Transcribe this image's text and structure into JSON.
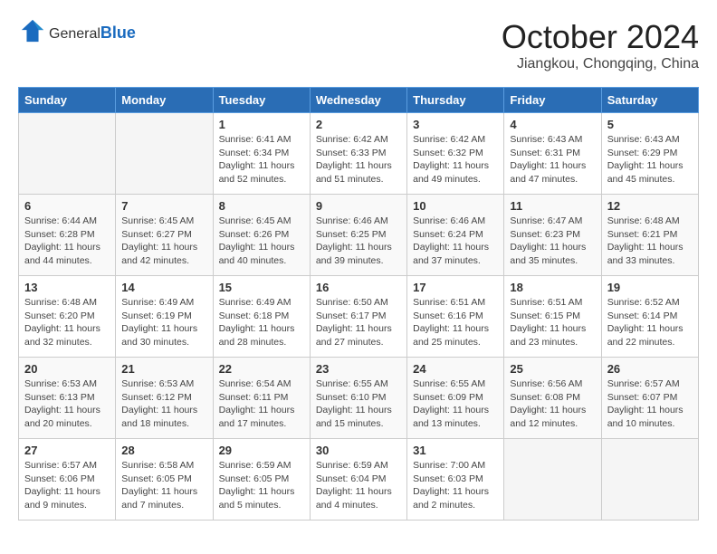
{
  "header": {
    "logo_general": "General",
    "logo_blue": "Blue",
    "month_title": "October 2024",
    "location": "Jiangkou, Chongqing, China"
  },
  "days_of_week": [
    "Sunday",
    "Monday",
    "Tuesday",
    "Wednesday",
    "Thursday",
    "Friday",
    "Saturday"
  ],
  "weeks": [
    [
      {
        "day": "",
        "info": "",
        "empty": true
      },
      {
        "day": "",
        "info": "",
        "empty": true
      },
      {
        "day": "1",
        "info": "Sunrise: 6:41 AM\nSunset: 6:34 PM\nDaylight: 11 hours and 52 minutes."
      },
      {
        "day": "2",
        "info": "Sunrise: 6:42 AM\nSunset: 6:33 PM\nDaylight: 11 hours and 51 minutes."
      },
      {
        "day": "3",
        "info": "Sunrise: 6:42 AM\nSunset: 6:32 PM\nDaylight: 11 hours and 49 minutes."
      },
      {
        "day": "4",
        "info": "Sunrise: 6:43 AM\nSunset: 6:31 PM\nDaylight: 11 hours and 47 minutes."
      },
      {
        "day": "5",
        "info": "Sunrise: 6:43 AM\nSunset: 6:29 PM\nDaylight: 11 hours and 45 minutes."
      }
    ],
    [
      {
        "day": "6",
        "info": "Sunrise: 6:44 AM\nSunset: 6:28 PM\nDaylight: 11 hours and 44 minutes."
      },
      {
        "day": "7",
        "info": "Sunrise: 6:45 AM\nSunset: 6:27 PM\nDaylight: 11 hours and 42 minutes."
      },
      {
        "day": "8",
        "info": "Sunrise: 6:45 AM\nSunset: 6:26 PM\nDaylight: 11 hours and 40 minutes."
      },
      {
        "day": "9",
        "info": "Sunrise: 6:46 AM\nSunset: 6:25 PM\nDaylight: 11 hours and 39 minutes."
      },
      {
        "day": "10",
        "info": "Sunrise: 6:46 AM\nSunset: 6:24 PM\nDaylight: 11 hours and 37 minutes."
      },
      {
        "day": "11",
        "info": "Sunrise: 6:47 AM\nSunset: 6:23 PM\nDaylight: 11 hours and 35 minutes."
      },
      {
        "day": "12",
        "info": "Sunrise: 6:48 AM\nSunset: 6:21 PM\nDaylight: 11 hours and 33 minutes."
      }
    ],
    [
      {
        "day": "13",
        "info": "Sunrise: 6:48 AM\nSunset: 6:20 PM\nDaylight: 11 hours and 32 minutes."
      },
      {
        "day": "14",
        "info": "Sunrise: 6:49 AM\nSunset: 6:19 PM\nDaylight: 11 hours and 30 minutes."
      },
      {
        "day": "15",
        "info": "Sunrise: 6:49 AM\nSunset: 6:18 PM\nDaylight: 11 hours and 28 minutes."
      },
      {
        "day": "16",
        "info": "Sunrise: 6:50 AM\nSunset: 6:17 PM\nDaylight: 11 hours and 27 minutes."
      },
      {
        "day": "17",
        "info": "Sunrise: 6:51 AM\nSunset: 6:16 PM\nDaylight: 11 hours and 25 minutes."
      },
      {
        "day": "18",
        "info": "Sunrise: 6:51 AM\nSunset: 6:15 PM\nDaylight: 11 hours and 23 minutes."
      },
      {
        "day": "19",
        "info": "Sunrise: 6:52 AM\nSunset: 6:14 PM\nDaylight: 11 hours and 22 minutes."
      }
    ],
    [
      {
        "day": "20",
        "info": "Sunrise: 6:53 AM\nSunset: 6:13 PM\nDaylight: 11 hours and 20 minutes."
      },
      {
        "day": "21",
        "info": "Sunrise: 6:53 AM\nSunset: 6:12 PM\nDaylight: 11 hours and 18 minutes."
      },
      {
        "day": "22",
        "info": "Sunrise: 6:54 AM\nSunset: 6:11 PM\nDaylight: 11 hours and 17 minutes."
      },
      {
        "day": "23",
        "info": "Sunrise: 6:55 AM\nSunset: 6:10 PM\nDaylight: 11 hours and 15 minutes."
      },
      {
        "day": "24",
        "info": "Sunrise: 6:55 AM\nSunset: 6:09 PM\nDaylight: 11 hours and 13 minutes."
      },
      {
        "day": "25",
        "info": "Sunrise: 6:56 AM\nSunset: 6:08 PM\nDaylight: 11 hours and 12 minutes."
      },
      {
        "day": "26",
        "info": "Sunrise: 6:57 AM\nSunset: 6:07 PM\nDaylight: 11 hours and 10 minutes."
      }
    ],
    [
      {
        "day": "27",
        "info": "Sunrise: 6:57 AM\nSunset: 6:06 PM\nDaylight: 11 hours and 9 minutes."
      },
      {
        "day": "28",
        "info": "Sunrise: 6:58 AM\nSunset: 6:05 PM\nDaylight: 11 hours and 7 minutes."
      },
      {
        "day": "29",
        "info": "Sunrise: 6:59 AM\nSunset: 6:05 PM\nDaylight: 11 hours and 5 minutes."
      },
      {
        "day": "30",
        "info": "Sunrise: 6:59 AM\nSunset: 6:04 PM\nDaylight: 11 hours and 4 minutes."
      },
      {
        "day": "31",
        "info": "Sunrise: 7:00 AM\nSunset: 6:03 PM\nDaylight: 11 hours and 2 minutes."
      },
      {
        "day": "",
        "info": "",
        "empty": true
      },
      {
        "day": "",
        "info": "",
        "empty": true
      }
    ]
  ]
}
